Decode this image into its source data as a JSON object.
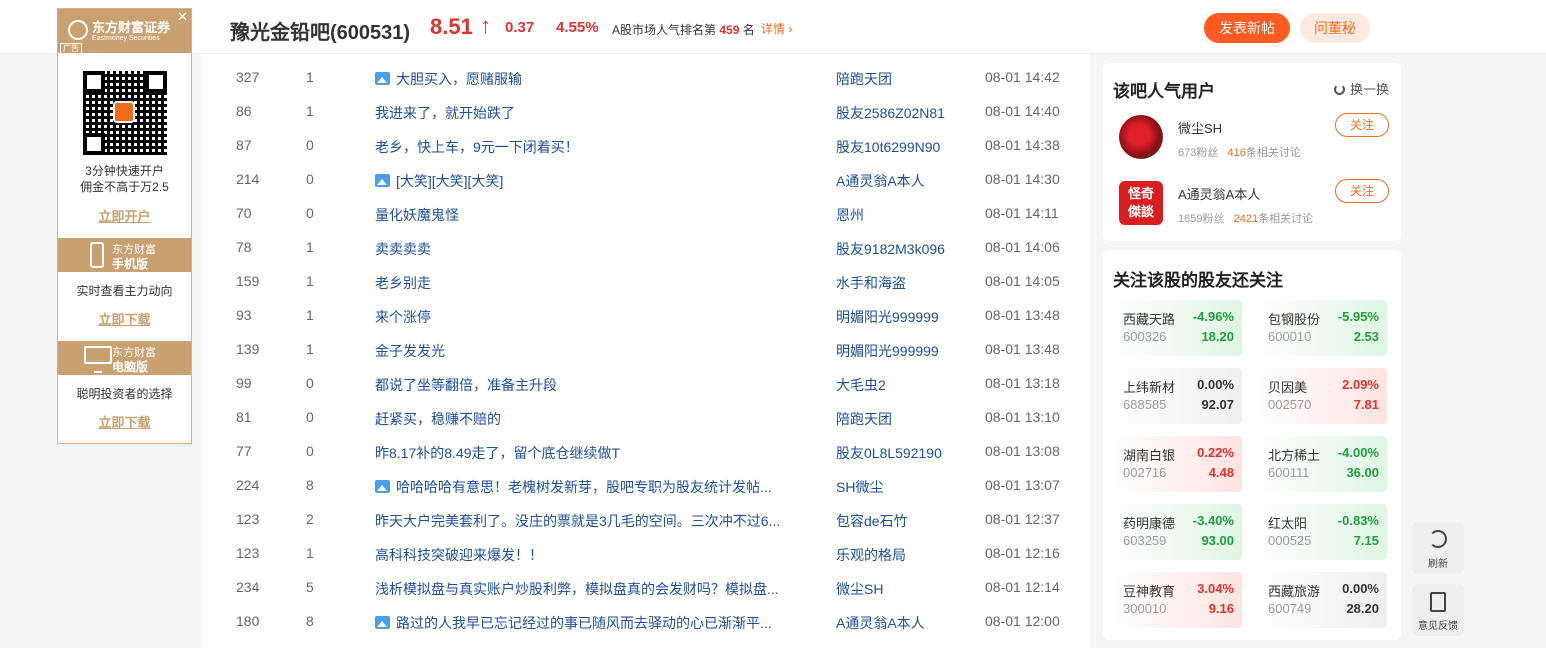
{
  "header": {
    "bar_name": "豫光金铅吧(600531)",
    "price": "8.51",
    "arrow": "↑",
    "change": "0.37",
    "change_pct": "4.55%",
    "rank_prefix": "A股市场人气排名第",
    "rank_num": "459",
    "rank_suffix": "名",
    "detail_link": "详情",
    "post_button": "发表新帖",
    "ask_button": "问董秘"
  },
  "ad": {
    "brand": "东方财富证券",
    "brand_sub": "Eastmoney Securities",
    "ad_tag": "广告",
    "close": "✕",
    "open_text_1": "3分钟快速开户",
    "open_text_2": "佣金不高于万2.5",
    "open_link": "立即开户",
    "mobile_brand": "东方财富",
    "mobile_label": "手机版",
    "mobile_text": "实时查看主力动向",
    "mobile_link": "立即下载",
    "pc_brand": "东方财富",
    "pc_label": "电脑版",
    "pc_text": "聪明投资者的选择",
    "pc_link": "立即下载"
  },
  "posts": [
    {
      "read": "327",
      "reply": "1",
      "img": true,
      "title": "大胆买入，愿赌服输",
      "author": "陪跑天团",
      "time": "08-01 14:42"
    },
    {
      "read": "86",
      "reply": "1",
      "img": false,
      "title": "我进来了，就开始跌了",
      "author": "股友2586Z02N81",
      "time": "08-01 14:40"
    },
    {
      "read": "87",
      "reply": "0",
      "img": false,
      "title": "老乡，快上车，9元一下闭着买！",
      "author": "股友10t6299N90",
      "time": "08-01 14:38"
    },
    {
      "read": "214",
      "reply": "0",
      "img": true,
      "title": "[大笑][大笑][大笑]",
      "author": "A通灵翁A本人",
      "time": "08-01 14:30"
    },
    {
      "read": "70",
      "reply": "0",
      "img": false,
      "title": "量化妖魔鬼怪",
      "author": "恩州",
      "time": "08-01 14:11"
    },
    {
      "read": "78",
      "reply": "1",
      "img": false,
      "title": "卖卖卖卖",
      "author": "股友9182M3k096",
      "time": "08-01 14:06"
    },
    {
      "read": "159",
      "reply": "1",
      "img": false,
      "title": "老乡别走",
      "author": "水手和海盗",
      "time": "08-01 14:05"
    },
    {
      "read": "93",
      "reply": "1",
      "img": false,
      "title": "来个涨停",
      "author": "明媚阳光999999",
      "time": "08-01 13:48"
    },
    {
      "read": "139",
      "reply": "1",
      "img": false,
      "title": "金子发发光",
      "author": "明媚阳光999999",
      "time": "08-01 13:48"
    },
    {
      "read": "99",
      "reply": "0",
      "img": false,
      "title": "都说了坐等翻倍，准备主升段",
      "author": "大毛虫2",
      "time": "08-01 13:18"
    },
    {
      "read": "81",
      "reply": "0",
      "img": false,
      "title": "赶紧买，稳赚不赔的",
      "author": "陪跑天团",
      "time": "08-01 13:10"
    },
    {
      "read": "77",
      "reply": "0",
      "img": false,
      "title": "昨8.17补的8.49走了，留个底仓继续做T",
      "author": "股友0L8L592190",
      "time": "08-01 13:08"
    },
    {
      "read": "224",
      "reply": "8",
      "img": true,
      "title": "哈哈哈哈有意思！老槐树发新芽，股吧专职为股友统计发帖...",
      "author": "SH微尘",
      "time": "08-01 13:07"
    },
    {
      "read": "123",
      "reply": "2",
      "img": false,
      "title": "昨天大户完美套利了。没庄的票就是3几毛的空间。三次冲不过6...",
      "author": "包容de石竹",
      "time": "08-01 12:37"
    },
    {
      "read": "123",
      "reply": "1",
      "img": false,
      "title": "高科科技突破迎来爆发！！",
      "author": "乐观的格局",
      "time": "08-01 12:16"
    },
    {
      "read": "234",
      "reply": "5",
      "img": false,
      "title": "浅析模拟盘与真实账户炒股利弊，模拟盘真的会发财吗？模拟盘...",
      "author": "微尘SH",
      "time": "08-01 12:14"
    },
    {
      "read": "180",
      "reply": "8",
      "img": true,
      "title": "路过的人我早已忘记经过的事已随风而去驿动的心已渐渐平...",
      "author": "A通灵翁A本人",
      "time": "08-01 12:00"
    }
  ],
  "popular": {
    "title": "该吧人气用户",
    "swap": "换一换",
    "users": [
      {
        "name": "微尘SH",
        "fans": "673粉丝",
        "discuss_num": "416",
        "discuss_suffix": "条相关讨论",
        "follow": "关注"
      },
      {
        "name": "A通灵翁A本人",
        "fans": "1859粉丝",
        "discuss_num": "2421",
        "discuss_suffix": "条相关讨论",
        "follow": "关注",
        "avatar_text": "怪奇傑談"
      }
    ]
  },
  "related": {
    "title": "关注该股的股友还关注",
    "stocks": [
      {
        "name": "西藏天路",
        "code": "600326",
        "pct": "-4.96%",
        "price": "18.20",
        "dir": "down"
      },
      {
        "name": "包钢股份",
        "code": "600010",
        "pct": "-5.95%",
        "price": "2.53",
        "dir": "down"
      },
      {
        "name": "上纬新材",
        "code": "688585",
        "pct": "0.00%",
        "price": "92.07",
        "dir": "flat"
      },
      {
        "name": "贝因美",
        "code": "002570",
        "pct": "2.09%",
        "price": "7.81",
        "dir": "up"
      },
      {
        "name": "湖南白银",
        "code": "002716",
        "pct": "0.22%",
        "price": "4.48",
        "dir": "up"
      },
      {
        "name": "北方稀土",
        "code": "600111",
        "pct": "-4.00%",
        "price": "36.00",
        "dir": "down"
      },
      {
        "name": "药明康德",
        "code": "603259",
        "pct": "-3.40%",
        "price": "93.00",
        "dir": "down"
      },
      {
        "name": "红太阳",
        "code": "000525",
        "pct": "-0.83%",
        "price": "7.15",
        "dir": "down"
      },
      {
        "name": "豆神教育",
        "code": "300010",
        "pct": "3.04%",
        "price": "9.16",
        "dir": "up"
      },
      {
        "name": "西藏旅游",
        "code": "600749",
        "pct": "0.00%",
        "price": "28.20",
        "dir": "flat"
      }
    ]
  },
  "float": {
    "refresh": "刷新",
    "feedback": "意见反馈"
  }
}
